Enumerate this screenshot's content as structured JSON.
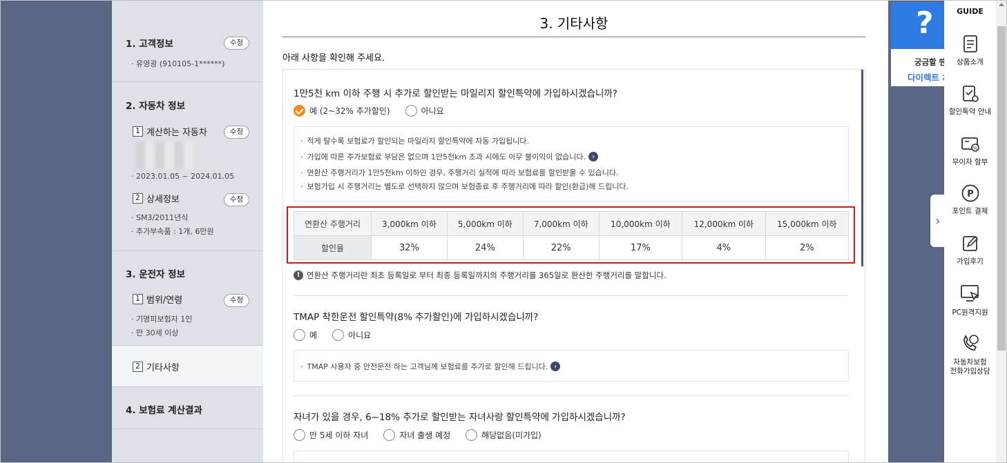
{
  "sidebar": {
    "sec1": {
      "title": "1. 고객정보",
      "edit": "수정",
      "line": "· 유영광 (910105-1******)"
    },
    "sec2": {
      "title": "2. 자동차 정보",
      "sub1": {
        "num": "1",
        "label": "계산하는 자동차",
        "edit": "수정",
        "line": "· 2023.01.05 ~ 2024.01.05"
      },
      "sub2": {
        "num": "2",
        "label": "상세정보",
        "edit": "수정",
        "lines": [
          "· SM3/2011년식",
          "· 추가부속품 : 1개, 6만원"
        ]
      }
    },
    "sec3": {
      "title": "3. 운전자 정보",
      "sub1": {
        "num": "1",
        "label": "범위/연령",
        "edit": "수정",
        "lines": [
          "· 기명피보험자 1인",
          "· 만 30세 이상"
        ]
      },
      "sub2": {
        "num": "2",
        "label": "기타사항"
      }
    },
    "sec4": {
      "title": "4. 보험료 계산결과"
    }
  },
  "main": {
    "title": "3. 기타사항",
    "intro": "아래 사항을 확인해 주세요.",
    "q1": {
      "question": "1만5천 km 이하 주행 시 추가로 할인받는 마일리지 할인특약에 가입하시겠습니까?",
      "opt_yes": "예 (2~32% 추가할인)",
      "opt_no": "아니요",
      "info": [
        "적게 탈수록 보험료가 할인되는 마일리지 할인특약에 자동 가입됩니다.",
        "가입에 따른 추가보험료 부담은 없으며 1만5천km 초과 시에도 아무 불이익이 없습니다.",
        "연환산 주행거리가 1만5천km 이하인 경우, 주행거리 실적에 따라 보험료를 할인받을 수 있습니다.",
        "보험가입 시 주행거리는 별도로 선택하지 않으며 보험종료 후 주행거리에 따라 할인(환급)해 드립니다."
      ],
      "table": {
        "row1_head": "연환산 주행거리",
        "row2_head": "할인율",
        "distances": [
          "3,000km 이하",
          "5,000km 이하",
          "7,000km 이하",
          "10,000km 이하",
          "12,000km 이하",
          "15,000km 이하"
        ],
        "rates": [
          "32%",
          "24%",
          "22%",
          "17%",
          "4%",
          "2%"
        ]
      },
      "note": "연환산 주행거리란 최초 등록일로 부터 최종 등록일까지의 주행거리를 365일로 환산한 주행거리를 말합니다."
    },
    "q2": {
      "question": "TMAP 착한운전 할인특약(8% 추가할인)에 가입하시겠습니까?",
      "opt_yes": "예",
      "opt_no": "아니요",
      "info": "TMAP 사용자 중 안전운전 하는 고객님께 보험료를 추가로 할인해 드립니다."
    },
    "q3": {
      "question": "자녀가 있을 경우, 6~18% 추가로 할인받는 자녀사랑 할인특약에 가입하시겠습니까?",
      "opts": [
        "만 5세 이하 자녀",
        "자녀 출생 예정",
        "해당없음(미가입)"
      ]
    }
  },
  "help_card": {
    "symbol": "?",
    "line1": "궁금할 땐",
    "line2": "다이렉트 채팅"
  },
  "guide": {
    "title": "GUIDE",
    "items": [
      {
        "icon": "document-icon",
        "label": "상품소개"
      },
      {
        "icon": "discount-doc-icon",
        "label": "할인특약 안내"
      },
      {
        "icon": "card-icon",
        "label": "무이자 할부"
      },
      {
        "icon": "point-icon",
        "label": "포인트 결제",
        "glyph": "P"
      },
      {
        "icon": "review-icon",
        "label": "가입후기"
      },
      {
        "icon": "remote-pc-icon",
        "label": "PC원격지원"
      },
      {
        "icon": "phone-consult-icon",
        "label": "자동차보험\n전화가입상담"
      }
    ]
  },
  "colors": {
    "accent_orange": "#f08a24",
    "highlight_red": "#d9151b",
    "brand_blue": "#2d7be0",
    "navy": "#3d4a6d"
  }
}
